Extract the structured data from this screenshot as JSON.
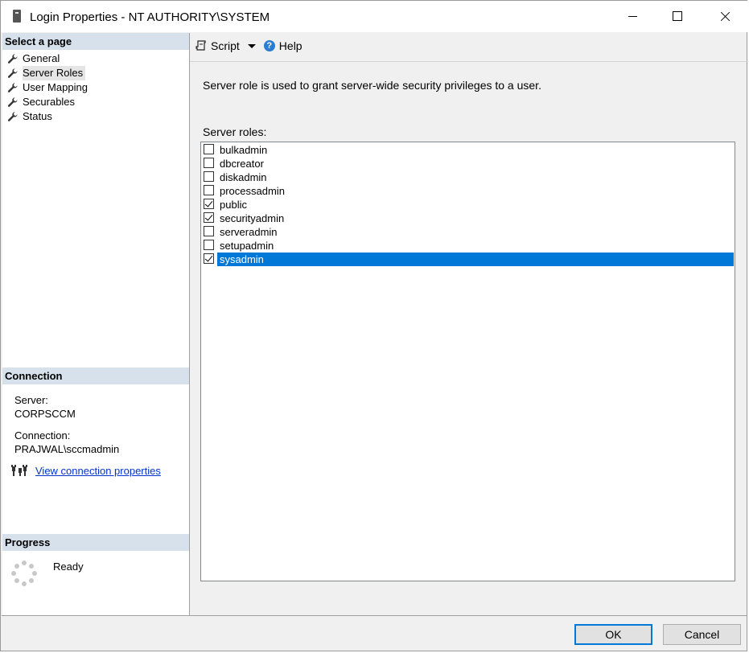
{
  "window": {
    "title": "Login Properties - NT AUTHORITY\\SYSTEM"
  },
  "left_panel": {
    "select_page_header": "Select a page",
    "pages": [
      {
        "label": "General",
        "icon": "wrench-icon",
        "selected": false
      },
      {
        "label": "Server Roles",
        "icon": "wrench-icon",
        "selected": true
      },
      {
        "label": "User Mapping",
        "icon": "wrench-icon",
        "selected": false
      },
      {
        "label": "Securables",
        "icon": "wrench-icon",
        "selected": false
      },
      {
        "label": "Status",
        "icon": "wrench-icon",
        "selected": false
      }
    ],
    "connection_header": "Connection",
    "server_label": "Server:",
    "server_value": "CORPSCCM",
    "connection_label": "Connection:",
    "connection_value": "PRAJWAL\\sccmadmin",
    "view_connection_link": "View connection properties",
    "progress_header": "Progress",
    "progress_status": "Ready"
  },
  "toolbar": {
    "script_label": "Script",
    "help_label": "Help"
  },
  "main": {
    "description": "Server role is used to grant server-wide security privileges to a user.",
    "roles_label": "Server roles:",
    "roles": [
      {
        "name": "bulkadmin",
        "checked": false,
        "selected": false
      },
      {
        "name": "dbcreator",
        "checked": false,
        "selected": false
      },
      {
        "name": "diskadmin",
        "checked": false,
        "selected": false
      },
      {
        "name": "processadmin",
        "checked": false,
        "selected": false
      },
      {
        "name": "public",
        "checked": true,
        "selected": false
      },
      {
        "name": "securityadmin",
        "checked": true,
        "selected": false
      },
      {
        "name": "serveradmin",
        "checked": false,
        "selected": false
      },
      {
        "name": "setupadmin",
        "checked": false,
        "selected": false
      },
      {
        "name": "sysadmin",
        "checked": true,
        "selected": true
      }
    ]
  },
  "footer": {
    "ok_label": "OK",
    "cancel_label": "Cancel"
  },
  "colors": {
    "selection": "#0078d7",
    "section_header": "#d6e1ec",
    "link": "#0033cc"
  }
}
